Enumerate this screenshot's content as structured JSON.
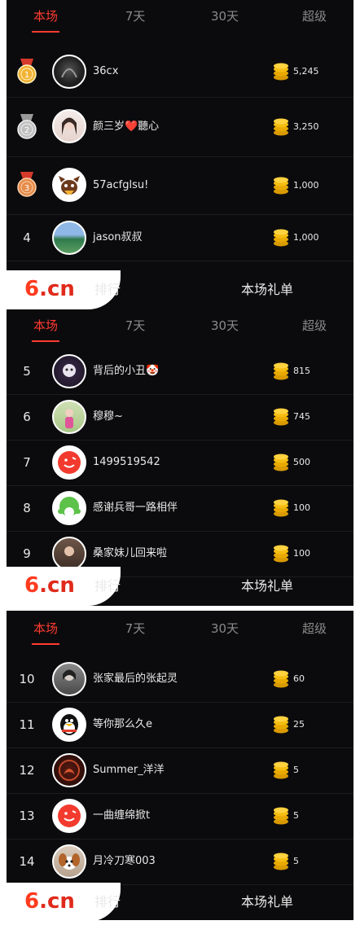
{
  "tabs": [
    "本场",
    "7天",
    "30天",
    "超级"
  ],
  "bottom_bar": {
    "logo_main": "6",
    "logo_sub": ".cn",
    "left_label": "排行",
    "right_label": "本场礼单"
  },
  "medal_colors": {
    "gold": "#f2b335",
    "silver": "#c0c0c0",
    "bronze": "#e58c4a"
  },
  "accent_color": "#ff3b30",
  "panels": [
    {
      "rows": [
        {
          "rank": "1",
          "medal": "gold",
          "name": "36cx",
          "amount": "5,245",
          "avatar": "dark"
        },
        {
          "rank": "2",
          "medal": "silver",
          "name": "颜三岁❤️聽心",
          "amount": "3,250",
          "avatar": "girl"
        },
        {
          "rank": "3",
          "medal": "bronze",
          "name": "57acfglsu!",
          "amount": "1,000",
          "avatar": "cartoon"
        },
        {
          "rank": "4",
          "medal": null,
          "name": "jason叔叔",
          "amount": "1,000",
          "avatar": "landscape"
        }
      ]
    },
    {
      "rows": [
        {
          "rank": "5",
          "name": "背后的小丑🤡",
          "amount": "815",
          "avatar": "clown"
        },
        {
          "rank": "6",
          "name": "穆穆~",
          "amount": "745",
          "avatar": "girl2"
        },
        {
          "rank": "7",
          "name": "1499519542",
          "amount": "500",
          "avatar": "red"
        },
        {
          "rank": "8",
          "name": "感谢兵哥一路相伴",
          "amount": "100",
          "avatar": "green"
        },
        {
          "rank": "9",
          "name": "桑家妹儿回来啦",
          "amount": "100",
          "avatar": "brown"
        }
      ]
    },
    {
      "rows": [
        {
          "rank": "10",
          "name": "张家最后的张起灵",
          "amount": "60",
          "avatar": "portrait"
        },
        {
          "rank": "11",
          "name": "等你那么久e",
          "amount": "25",
          "avatar": "qq"
        },
        {
          "rank": "12",
          "name": "Summer_洋洋",
          "amount": "5",
          "avatar": "dragon"
        },
        {
          "rank": "13",
          "name": "一曲缠绵掀t",
          "amount": "5",
          "avatar": "red"
        },
        {
          "rank": "14",
          "name": "月冷刀寒003",
          "amount": "5",
          "avatar": "dog"
        }
      ]
    }
  ]
}
